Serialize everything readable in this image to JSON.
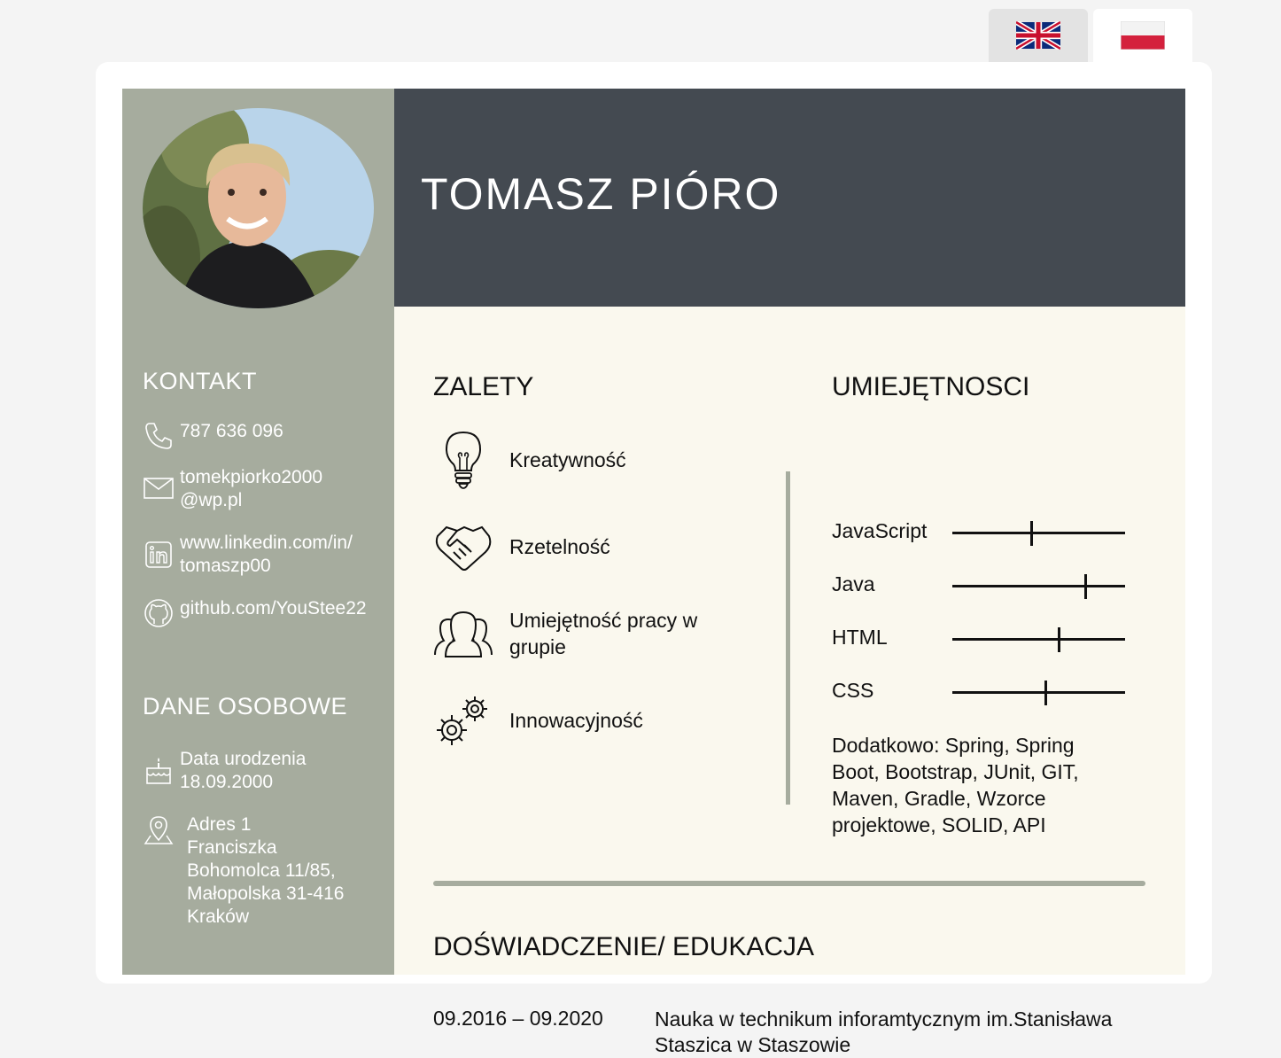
{
  "languages": [
    {
      "code": "en",
      "icon": "uk-flag-icon"
    },
    {
      "code": "pl",
      "icon": "poland-flag-icon"
    }
  ],
  "profile": {
    "name": "TOMASZ PIÓRO",
    "photo": "profile-photo"
  },
  "colors": {
    "sidebar": "#a6ac9e",
    "header": "#444a51",
    "main": "#faf8ee"
  },
  "contact": {
    "heading": "KONTAKT",
    "phone": {
      "icon": "phone-icon",
      "text": "787 636 096"
    },
    "email": {
      "icon": "mail-icon",
      "text": "tomekpiorko2000\n@wp.pl"
    },
    "linkedin": {
      "icon": "linkedin-icon",
      "text": "www.linkedin.com/in/\ntomaszp00"
    },
    "github": {
      "icon": "github-icon",
      "text": "github.com/YouStee22"
    }
  },
  "personal": {
    "heading": "DANE OSOBOWE",
    "birth": {
      "icon": "cake-icon",
      "text": "Data urodzenia\n18.09.2000"
    },
    "address": {
      "icon": "location-pin-icon",
      "text": "Adres 1\nFranciszka\nBohomolca 11/85,\nMałopolska 31-416\nKraków"
    }
  },
  "strengths": {
    "heading": "ZALETY",
    "items": [
      {
        "icon": "lightbulb-icon",
        "label": "Kreatywność"
      },
      {
        "icon": "handshake-icon",
        "label": "Rzetelność"
      },
      {
        "icon": "people-icon",
        "label": "Umiejętność pracy w\ngrupie"
      },
      {
        "icon": "gears-icon",
        "label": "Innowacyjność"
      }
    ]
  },
  "skills": {
    "heading": "UMIEJĘTNOSCI",
    "items": [
      {
        "label": "JavaScript",
        "level": 0.46
      },
      {
        "label": "Java",
        "level": 0.77
      },
      {
        "label": "HTML",
        "level": 0.62
      },
      {
        "label": "CSS",
        "level": 0.54
      }
    ],
    "extra": "Dodatkowo: Spring, Spring Boot, Bootstrap, JUnit, GIT, Maven, Gradle, Wzorce projektowe, SOLID, API"
  },
  "experience": {
    "heading": "DOŚWIADCZENIE/ EDUKACJA",
    "items": [
      {
        "date": "09.2016 – 09.2020",
        "description": "Nauka w technikum inforamtycznym im.Stanisława Staszica w Staszowie"
      }
    ]
  }
}
